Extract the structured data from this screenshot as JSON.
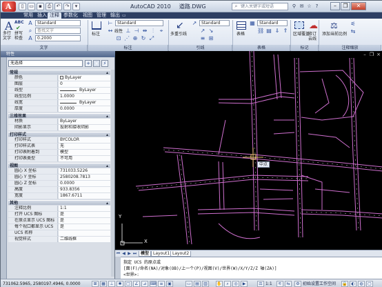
{
  "app": {
    "title": "AutoCAD 2010",
    "filename": "道路.DWG"
  },
  "titlebar": {
    "search_placeholder": "键入关键字或短语"
  },
  "tabs": [
    "常用",
    "插入",
    "注释",
    "参数化",
    "视图",
    "管理",
    "输出"
  ],
  "ribbon": {
    "text_panel": {
      "label": "文字",
      "big1": "多行\n文字",
      "big2_top": "ABC",
      "big2": "拼写\n检查",
      "style": "Standard",
      "find_placeholder": "查找文字",
      "height": "0.2000"
    },
    "dim_panel": {
      "label": "标注",
      "linear": "线性",
      "style": "Standard",
      "big": "标注"
    },
    "leader_panel": {
      "label": "引线",
      "big": "多重引线",
      "style": "Standard"
    },
    "table_panel": {
      "label": "表格",
      "big": "表格",
      "style": "Standard"
    },
    "mark_panel": {
      "label": "标记",
      "btn1": "区域覆盖",
      "btn2": "修订\n云线"
    },
    "scale_panel": {
      "label": "注释缩放",
      "btn": "添加当前比例"
    }
  },
  "palette": {
    "title": "特性",
    "selection": "无选择",
    "sections": [
      {
        "name": "常规",
        "rows": [
          {
            "k": "颜色",
            "v": "ByLayer",
            "chk": true
          },
          {
            "k": "图层",
            "v": "0"
          },
          {
            "k": "线型",
            "v": "ByLayer",
            "line": true
          },
          {
            "k": "线型比例",
            "v": "1.0000"
          },
          {
            "k": "线宽",
            "v": "ByLayer",
            "line": true
          },
          {
            "k": "厚度",
            "v": "0.0000"
          }
        ]
      },
      {
        "name": "三维效果",
        "rows": [
          {
            "k": "材质",
            "v": "ByLayer"
          },
          {
            "k": "阴影显示",
            "v": "投射和接收阴影"
          }
        ]
      },
      {
        "name": "打印样式",
        "rows": [
          {
            "k": "打印样式",
            "v": "BYCOLOR"
          },
          {
            "k": "打印样式表",
            "v": "无"
          },
          {
            "k": "打印表附着到",
            "v": "模型"
          },
          {
            "k": "打印表类型",
            "v": "不可用"
          }
        ]
      },
      {
        "name": "视图",
        "rows": [
          {
            "k": "圆心 X 坐标",
            "v": "731033.5226"
          },
          {
            "k": "圆心 Y 坐标",
            "v": "2580208.7813"
          },
          {
            "k": "圆心 Z 坐标",
            "v": "0.0000"
          },
          {
            "k": "高度",
            "v": "933.8356"
          },
          {
            "k": "宽度",
            "v": "1867.6711"
          }
        ]
      },
      {
        "name": "其他",
        "rows": [
          {
            "k": "注释比例",
            "v": "1:1"
          },
          {
            "k": "打开 UCS 图标",
            "v": "是"
          },
          {
            "k": "在原点显示 UCS 图标",
            "v": "是"
          },
          {
            "k": "每个视口都显示 UCS",
            "v": "是"
          },
          {
            "k": "UCS 名称",
            "v": ""
          },
          {
            "k": "视觉样式",
            "v": "二维线框"
          }
        ]
      }
    ]
  },
  "canvas": {
    "tooltip": "中点",
    "ucs_y": "Y",
    "ucs_x": "X"
  },
  "layout_tabs": [
    "模型",
    "Layout1",
    "Layout2"
  ],
  "command": {
    "line1": "指定 UCS 的原点或",
    "line2": "[面(F)/命名(NA)/对象(OB)/上一个(P)/视图(V)/世界(W)/X/Y/Z/Z 轴(ZA)]",
    "line3": "<世界>:"
  },
  "statusbar": {
    "coords": "731062.5965, 2580197.4946, 0.0000",
    "scale": "1:1",
    "workspace": "初始设置工作空间"
  },
  "colors": {
    "road": "#d070d0",
    "canvas": "#000000",
    "tooltip_bg": "#e8eef8"
  }
}
